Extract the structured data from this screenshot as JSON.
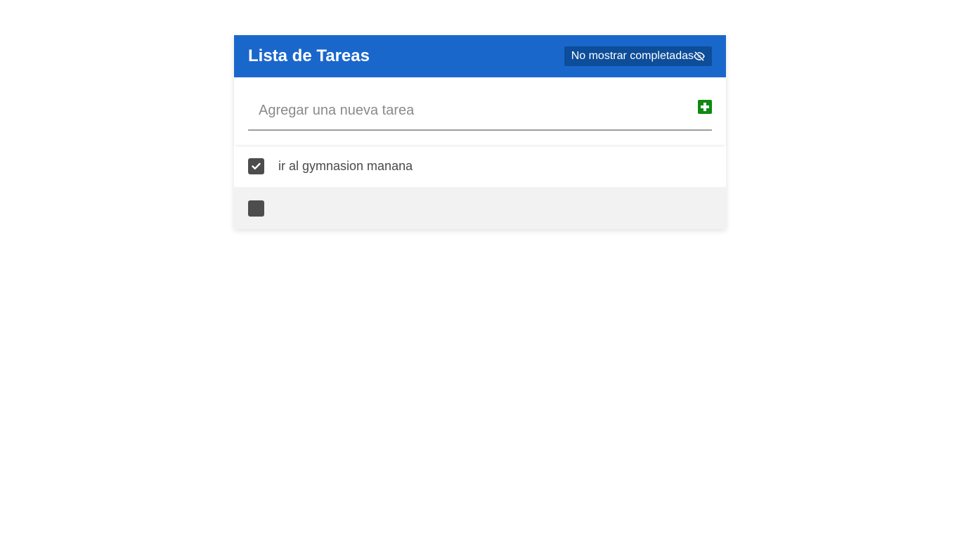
{
  "header": {
    "title": "Lista de Tareas",
    "toggle_label": "No mostrar completadas",
    "toggle_icon": "eye-slash-icon"
  },
  "new_task": {
    "placeholder": "Agregar una nueva tarea",
    "value": "",
    "add_icon": "plus-square-icon"
  },
  "tasks": [
    {
      "text": "ir al gymnasion manana",
      "completed": true
    },
    {
      "text": "",
      "completed": false
    }
  ],
  "colors": {
    "header_bg": "#1a67cc",
    "toggle_bg": "#0d4d99",
    "add_button": "#0f8a10",
    "checkbox": "#4d4d4d",
    "alt_row": "#f2f2f2"
  }
}
